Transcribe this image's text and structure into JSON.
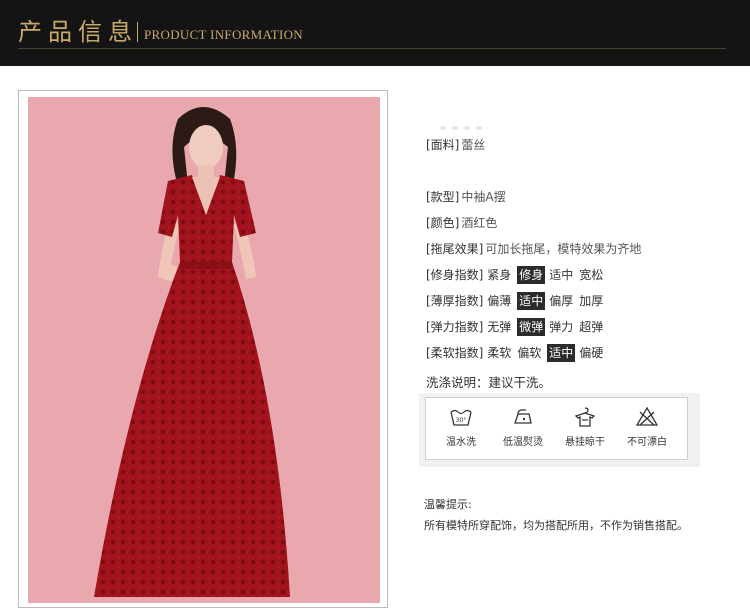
{
  "header": {
    "title_cn": "产品信息",
    "title_en": "PRODUCT INFORMATION"
  },
  "specs": {
    "fabric": {
      "key": "[面料]",
      "value": "蕾丝"
    },
    "style": {
      "key": "[款型]",
      "value": "中袖A摆"
    },
    "color": {
      "key": "[颜色]",
      "value": "酒红色"
    },
    "train": {
      "key": "[拖尾效果]",
      "value": "可加长拖尾，模特效果为齐地"
    },
    "fit": {
      "key": "[修身指数]",
      "options": [
        "紧身",
        "修身",
        "适中",
        "宽松"
      ],
      "selected": "修身"
    },
    "thickness": {
      "key": "[薄厚指数]",
      "options": [
        "偏薄",
        "适中",
        "偏厚",
        "加厚"
      ],
      "selected": "适中"
    },
    "elasticity": {
      "key": "[弹力指数]",
      "options": [
        "无弹",
        "微弹",
        "弹力",
        "超弹"
      ],
      "selected": "微弹"
    },
    "softness": {
      "key": "[柔软指数]",
      "options": [
        "柔软",
        "偏软",
        "适中",
        "偏硬"
      ],
      "selected": "适中"
    }
  },
  "washing": "洗涤说明：建议干洗。",
  "care": [
    {
      "icon": "warm-water-wash-icon",
      "label": "温水洗"
    },
    {
      "icon": "low-temp-iron-icon",
      "label": "低温熨烫"
    },
    {
      "icon": "hang-dry-icon",
      "label": "悬挂晾干"
    },
    {
      "icon": "no-bleach-icon",
      "label": "不可漂白"
    }
  ],
  "tip": {
    "title": "温馨提示:",
    "text": "所有模特所穿配饰，均为搭配所用，不作为销售搭配。"
  },
  "colors": {
    "header_bg": "#141414",
    "header_gold": "#c9a96a",
    "photo_bg": "#e8a8ad",
    "dress_red": "#a3131d",
    "selected_bg": "#2b2b2b"
  }
}
